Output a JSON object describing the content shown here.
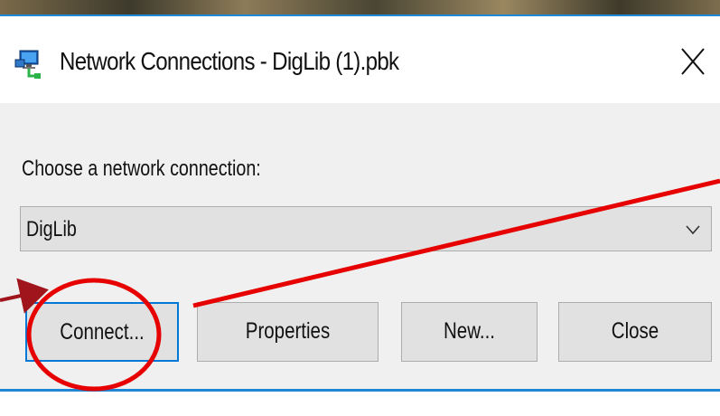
{
  "dialog": {
    "title": "Network Connections - DigLib (1).pbk",
    "close_glyph": "X",
    "app_icon": "network-connections-icon"
  },
  "form": {
    "choose_label": "Choose a network connection:",
    "selected_connection": "DigLib",
    "dropdown_icon": "chevron-down-icon"
  },
  "buttons": {
    "connect": "Connect...",
    "properties": "Properties",
    "new": "New...",
    "close": "Close"
  },
  "colors": {
    "accent": "#1e88d6",
    "focus_border": "#0078d7",
    "annotation_red": "#e60000",
    "annotation_dark_red": "#a0141c",
    "button_face": "#e1e1e1",
    "dialog_face": "#f0f0f0"
  }
}
